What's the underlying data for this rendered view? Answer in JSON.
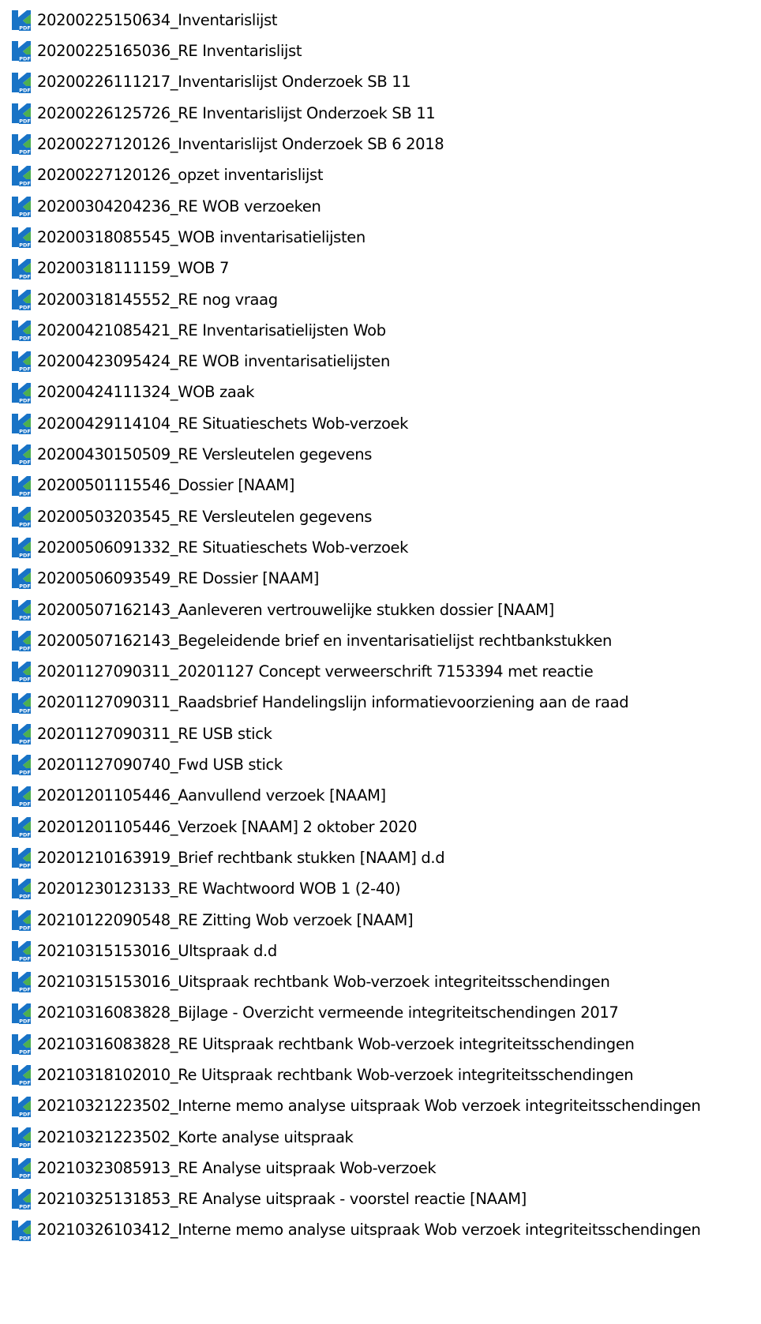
{
  "icon": {
    "name": "pdf-file-icon",
    "label": "PDF",
    "colors": {
      "blue": "#1873c6",
      "green": "#4caf50"
    }
  },
  "files": [
    {
      "name": "20200225150634_Inventarislijst"
    },
    {
      "name": "20200225165036_RE Inventarislijst"
    },
    {
      "name": "20200226111217_Inventarislijst Onderzoek SB 11"
    },
    {
      "name": "20200226125726_RE Inventarislijst Onderzoek SB 11"
    },
    {
      "name": "20200227120126_Inventarislijst Onderzoek SB 6 2018"
    },
    {
      "name": "20200227120126_opzet inventarislijst"
    },
    {
      "name": "20200304204236_RE WOB verzoeken"
    },
    {
      "name": "20200318085545_WOB inventarisatielijsten"
    },
    {
      "name": "20200318111159_WOB 7"
    },
    {
      "name": "20200318145552_RE nog vraag"
    },
    {
      "name": "20200421085421_RE Inventarisatielijsten Wob"
    },
    {
      "name": "20200423095424_RE WOB inventarisatielijsten"
    },
    {
      "name": "20200424111324_WOB zaak"
    },
    {
      "name": "20200429114104_RE Situatieschets Wob-verzoek"
    },
    {
      "name": "20200430150509_RE Versleutelen gegevens"
    },
    {
      "name": "20200501115546_Dossier [NAAM]"
    },
    {
      "name": "20200503203545_RE Versleutelen gegevens"
    },
    {
      "name": "20200506091332_RE Situatieschets Wob-verzoek"
    },
    {
      "name": "20200506093549_RE Dossier [NAAM]"
    },
    {
      "name": "20200507162143_Aanleveren vertrouwelijke stukken dossier [NAAM]"
    },
    {
      "name": "20200507162143_Begeleidende brief en inventarisatielijst rechtbankstukken"
    },
    {
      "name": "20201127090311_20201127 Concept verweerschrift 7153394 met reactie"
    },
    {
      "name": "20201127090311_Raadsbrief Handelingslijn informatievoorziening aan de raad"
    },
    {
      "name": "20201127090311_RE USB stick"
    },
    {
      "name": "20201127090740_Fwd USB stick"
    },
    {
      "name": "20201201105446_Aanvullend verzoek [NAAM]"
    },
    {
      "name": "20201201105446_Verzoek [NAAM] 2 oktober 2020"
    },
    {
      "name": "20201210163919_Brief rechtbank stukken [NAAM] d.d"
    },
    {
      "name": "20201230123133_RE Wachtwoord WOB 1 (2-40)"
    },
    {
      "name": "20210122090548_RE Zitting Wob verzoek [NAAM]"
    },
    {
      "name": "20210315153016_Ultspraak d.d"
    },
    {
      "name": "20210315153016_Uitspraak rechtbank Wob-verzoek integriteitsschendingen"
    },
    {
      "name": "20210316083828_Bijlage - Overzicht vermeende integriteitschendingen 2017"
    },
    {
      "name": "20210316083828_RE Uitspraak rechtbank Wob-verzoek integriteitsschendingen"
    },
    {
      "name": "20210318102010_Re Uitspraak rechtbank Wob-verzoek integriteitsschendingen"
    },
    {
      "name": "20210321223502_Interne memo analyse uitspraak Wob verzoek integriteitsschendingen"
    },
    {
      "name": "20210321223502_Korte analyse uitspraak"
    },
    {
      "name": "20210323085913_RE Analyse uitspraak Wob-verzoek"
    },
    {
      "name": "20210325131853_RE Analyse uitspraak - voorstel reactie [NAAM]"
    },
    {
      "name": "20210326103412_Interne memo analyse uitspraak Wob verzoek integriteitsschendingen"
    }
  ]
}
